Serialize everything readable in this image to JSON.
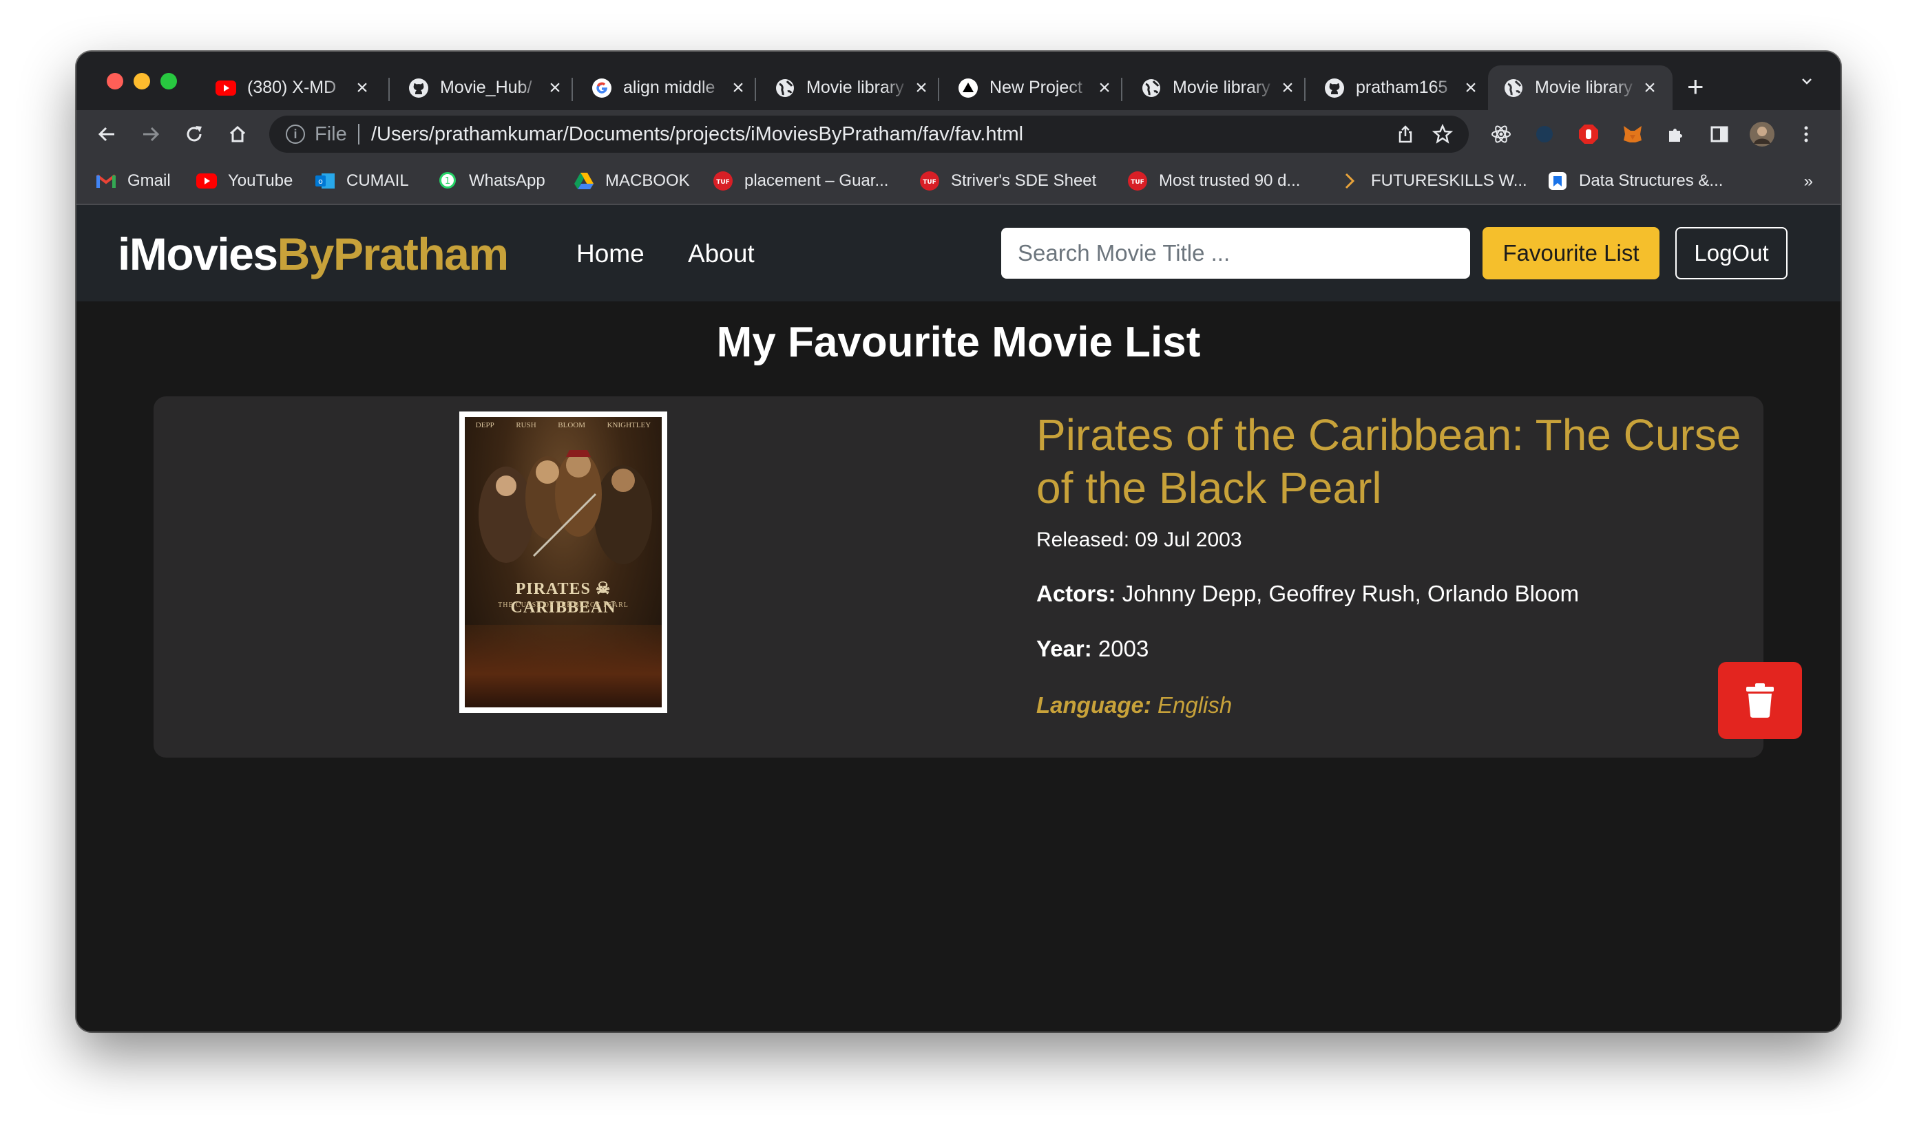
{
  "browser": {
    "tabs": [
      {
        "title": "(380) X-MD",
        "icon": "youtube"
      },
      {
        "title": "Movie_Hub/",
        "icon": "github"
      },
      {
        "title": "align middle",
        "icon": "google"
      },
      {
        "title": "Movie library",
        "icon": "globe"
      },
      {
        "title": "New Project",
        "icon": "vercel"
      },
      {
        "title": "Movie library",
        "icon": "globe"
      },
      {
        "title": "pratham165",
        "icon": "github"
      },
      {
        "title": "Movie library",
        "icon": "globe",
        "active": true
      }
    ],
    "close_glyph": "×",
    "new_tab_glyph": "+",
    "address": {
      "scheme_label": "File",
      "url": "/Users/prathamkumar/Documents/projects/iMoviesByPratham/fav/fav.html"
    },
    "bookmarks": [
      {
        "label": "Gmail",
        "icon": "gmail"
      },
      {
        "label": "YouTube",
        "icon": "youtube"
      },
      {
        "label": "CUMAIL",
        "icon": "outlook"
      },
      {
        "label": "WhatsApp",
        "icon": "whatsapp"
      },
      {
        "label": "MACBOOK",
        "icon": "drive"
      },
      {
        "label": "placement – Guar...",
        "icon": "tuf"
      },
      {
        "label": "Striver's SDE Sheet",
        "icon": "tuf"
      },
      {
        "label": "Most trusted 90 d...",
        "icon": "tuf"
      },
      {
        "label": "FUTURESKILLS W...",
        "icon": "chevron"
      },
      {
        "label": "Data Structures &...",
        "icon": "bookmark"
      }
    ],
    "bookmarks_overflow": "»"
  },
  "site": {
    "brand_part1": "iMovies",
    "brand_part2": "ByPratham",
    "nav": {
      "home": "Home",
      "about": "About"
    },
    "search_placeholder": "Search Movie Title ...",
    "favourite_button": "Favourite List",
    "logout_button": "LogOut"
  },
  "main": {
    "heading": "My Favourite Movie List",
    "movies": [
      {
        "title": "Pirates of the Caribbean: The Curse of the Black Pearl",
        "released": "Released: 09 Jul 2003",
        "actors_label": "Actors:",
        "actors": " Johnny Depp, Geoffrey Rush, Orlando Bloom",
        "year_label": "Year:",
        "year": " 2003",
        "language_label": "Language:",
        "language": " English",
        "poster": {
          "names": [
            "DEPP",
            "RUSH",
            "BLOOM",
            "KNIGHTLEY"
          ],
          "title_left": "PIRATES",
          "title_right": "CARIBBEAN",
          "subtitle": "THE CURSE OF THE BLACK PEARL"
        }
      }
    ]
  },
  "colors": {
    "brand_accent": "#c8a23a",
    "favourite_button": "#f5bf2c",
    "delete_button": "#e3251f",
    "navbar": "#212529",
    "page_bg": "#181818",
    "card_bg": "#2a292a"
  }
}
